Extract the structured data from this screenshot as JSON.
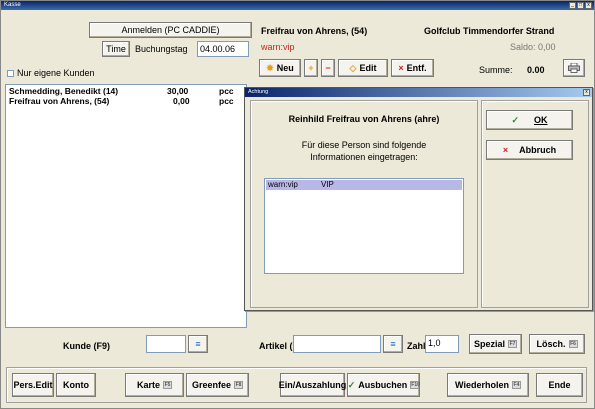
{
  "window": {
    "title": "Kasse",
    "btn_min": "_",
    "btn_max": "□",
    "btn_close": "x"
  },
  "top": {
    "anmelden_label": "Anmelden (PC CADDIE)",
    "time_label": "Time",
    "buchungstag_label": "Buchungstag",
    "buchungstag_value": "04.00.06",
    "nur_eigene_label": "Nur eigene Kunden"
  },
  "customers": [
    {
      "name": "Schmedding, Benedikt (14)",
      "amount": "30,00",
      "unit": "pcc"
    },
    {
      "name": "Freifrau von Ahrens, (54)",
      "amount": "0,00",
      "unit": "pcc"
    }
  ],
  "header": {
    "person": "Freifrau von Ahrens, (54)",
    "club": "Golfclub Timmendorfer Strand",
    "tag": "warn:vip",
    "saldo": "Saldo: 0,00",
    "summe_label": "Summe:",
    "summe_value": "0.00"
  },
  "toolbar": {
    "neu": "Neu",
    "edit": "Edit",
    "entf": "Entf.",
    "icon_star": "✸",
    "icon_plus": "+",
    "icon_minus": "−",
    "icon_diamond": "◇",
    "icon_x": "×"
  },
  "dialog": {
    "title": "Achtung",
    "close": "x",
    "person_line": "Reinhild Freifrau von Ahrens (ahre)",
    "info_line1": "Für diese Person sind folgende",
    "info_line2": "Informationen eingetragen:",
    "entries": [
      {
        "key": "warn:vip",
        "value": "VIP"
      }
    ],
    "ok_label": "OK",
    "abbruch_label": "Abbruch",
    "ok_glyph": "✓",
    "abbruch_glyph": "×"
  },
  "bottom_inputs": {
    "kunde_label": "Kunde (F9)",
    "artikel_label": "Artikel (F1)",
    "zahl_label": "Zahl",
    "zahl_value": "1,0",
    "spezial_label": "Spezial",
    "spezial_key": "F7",
    "losch_label": "Lösch.",
    "losch_key": "F6",
    "search_glyph": "≡"
  },
  "bottom_buttons": {
    "pers_edit": "Pers.Edit",
    "konto": "Konto",
    "karte": "Karte",
    "karte_key": "F5",
    "greenfee": "Greenfee",
    "greenfee_key": "F8",
    "einauszahlung": "Ein/Auszahlung",
    "ausbuchen": "Ausbuchen",
    "ausbuchen_key": "F10",
    "ausbuchen_glyph": "✓",
    "wiederholen": "Wiederholen",
    "wiederholen_key": "F4",
    "ende": "Ende"
  }
}
